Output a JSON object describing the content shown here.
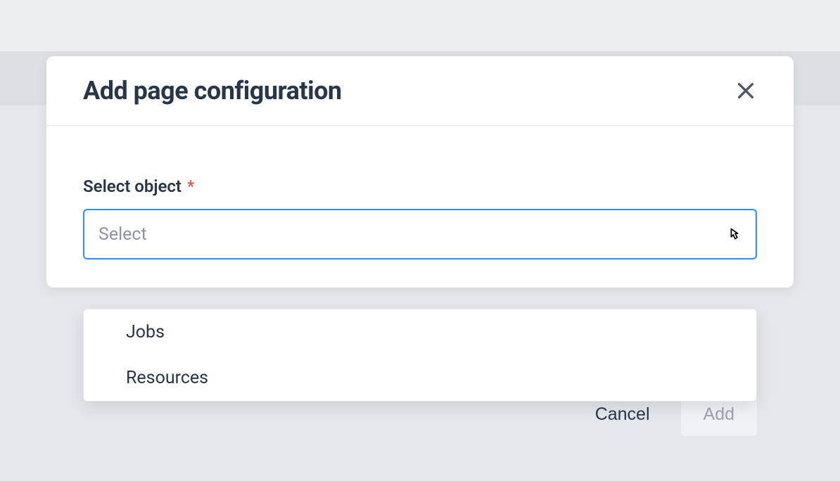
{
  "modal": {
    "title": "Add page configuration",
    "field_label": "Select object",
    "required_marker": "*",
    "select_placeholder": "Select",
    "options": [
      "Jobs",
      "Resources"
    ],
    "cancel_label": "Cancel",
    "add_label": "Add"
  }
}
